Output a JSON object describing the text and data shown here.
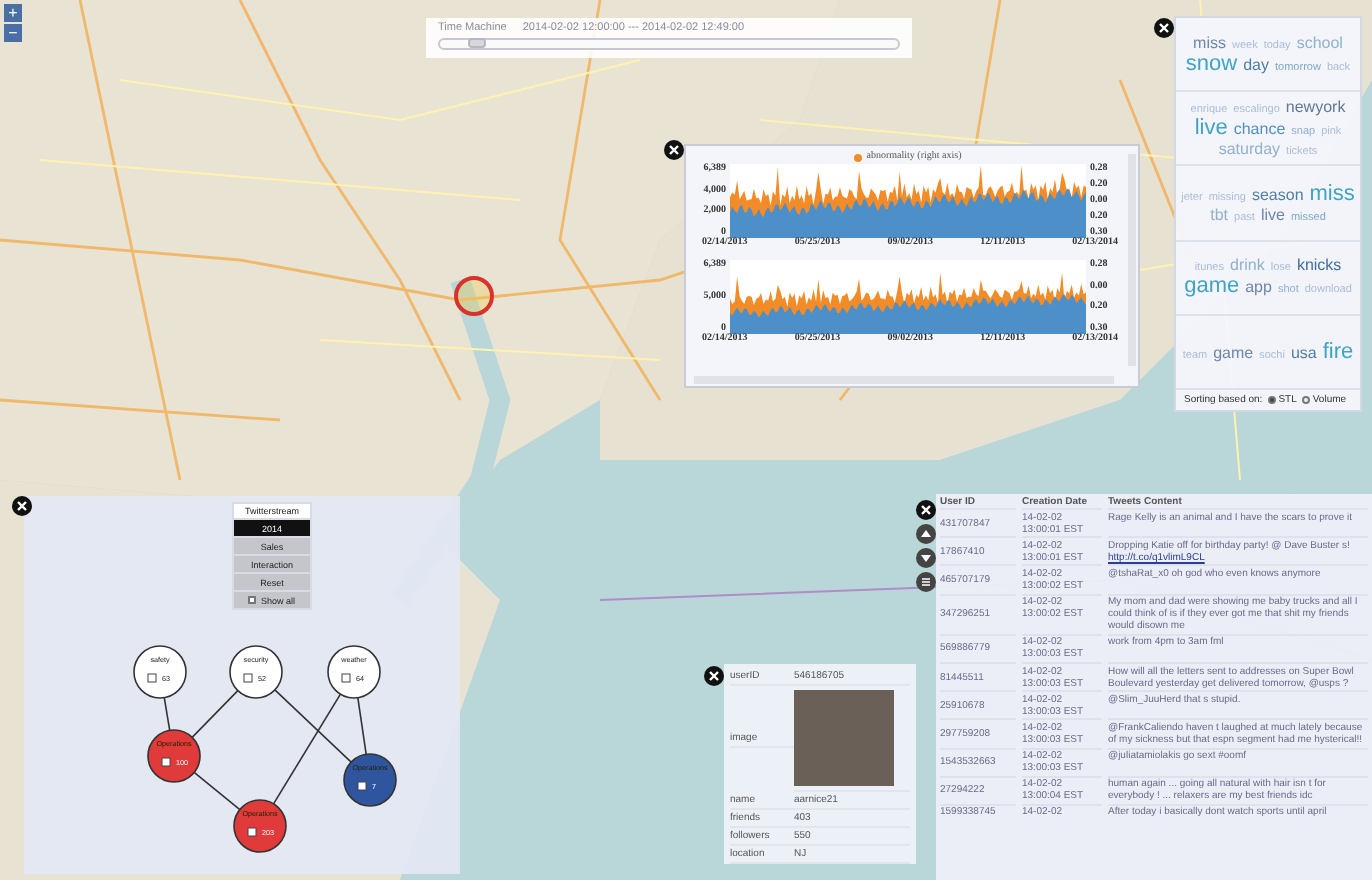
{
  "map": {
    "zoom_in": "+",
    "zoom_out": "−"
  },
  "time_machine": {
    "title": "Time Machine",
    "range": "2014-02-02 12:00:00 --- 2014-02-02 12:49:00",
    "level": 0.08
  },
  "trend_panel": {
    "charts": [
      {
        "legend": "abnormality (right axis)",
        "left_ticks": [
          "6,389",
          "4,000",
          "2,000",
          "0"
        ],
        "right_ticks": [
          "0.28",
          "0.20",
          "0.00",
          "0.20",
          "0.30"
        ],
        "x_labels": [
          "02/14/2013",
          "05/25/2013",
          "09/02/2013",
          "12/11/2013",
          "02/13/2014"
        ]
      },
      {
        "left_ticks": [
          "6,389",
          "5,000",
          "0"
        ],
        "right_ticks": [
          "0.28",
          "0.00",
          "0.20",
          "0.30"
        ],
        "x_labels": [
          "02/14/2013",
          "05/25/2013",
          "09/02/2013",
          "12/11/2013",
          "02/13/2014"
        ]
      }
    ]
  },
  "word_cloud": {
    "sections": [
      {
        "words": [
          {
            "text": "miss",
            "kind": "medium",
            "color": "#6f86a8"
          },
          {
            "text": "week",
            "kind": "small",
            "color": "#a9bdd6"
          },
          {
            "text": "today",
            "kind": "small",
            "color": "#a9bdd6"
          },
          {
            "text": "school",
            "kind": "medium",
            "color": "#8fb0cf"
          },
          {
            "text": "snow",
            "kind": "large",
            "color": "#3fa3c6"
          },
          {
            "text": "day",
            "kind": "medium",
            "color": "#4f7ea8"
          },
          {
            "text": "tomorrow",
            "kind": "small",
            "color": "#7fa6c8"
          },
          {
            "text": "back",
            "kind": "small",
            "color": "#a9bdd6"
          }
        ]
      },
      {
        "words": [
          {
            "text": "enrique",
            "kind": "small",
            "color": "#a9bdd6"
          },
          {
            "text": "escalingo",
            "kind": "small",
            "color": "#a9bdd6"
          },
          {
            "text": "newyork",
            "kind": "medium",
            "color": "#5f7898"
          },
          {
            "text": "live",
            "kind": "large",
            "color": "#3fa3c6"
          },
          {
            "text": "chance",
            "kind": "medium",
            "color": "#4f8fbf"
          },
          {
            "text": "snap",
            "kind": "small",
            "color": "#8fb0cf"
          },
          {
            "text": "pink",
            "kind": "small",
            "color": "#a9bdd6"
          },
          {
            "text": "saturday",
            "kind": "medium",
            "color": "#8fb0cf"
          },
          {
            "text": "tickets",
            "kind": "small",
            "color": "#a9bdd6"
          }
        ]
      },
      {
        "words": [
          {
            "text": "jeter",
            "kind": "small",
            "color": "#a9bdd6"
          },
          {
            "text": "missing",
            "kind": "small",
            "color": "#a9bdd6"
          },
          {
            "text": "season",
            "kind": "medium",
            "color": "#4f7ea8"
          },
          {
            "text": "miss",
            "kind": "large",
            "color": "#3fa3c6"
          },
          {
            "text": "tbt",
            "kind": "medium",
            "color": "#8fb0cf"
          },
          {
            "text": "past",
            "kind": "small",
            "color": "#a9bdd6"
          },
          {
            "text": "live",
            "kind": "medium",
            "color": "#6f86a8"
          },
          {
            "text": "missed",
            "kind": "small",
            "color": "#7fa6c8"
          }
        ]
      },
      {
        "words": [
          {
            "text": "itunes",
            "kind": "small",
            "color": "#a9bdd6"
          },
          {
            "text": "drink",
            "kind": "medium",
            "color": "#8fb0cf"
          },
          {
            "text": "lose",
            "kind": "small",
            "color": "#a9bdd6"
          },
          {
            "text": "knicks",
            "kind": "medium",
            "color": "#3f6f9a"
          },
          {
            "text": "game",
            "kind": "large",
            "color": "#3fa3c6"
          },
          {
            "text": "app",
            "kind": "medium",
            "color": "#6f86a8"
          },
          {
            "text": "shot",
            "kind": "small",
            "color": "#8fb0cf"
          },
          {
            "text": "download",
            "kind": "small",
            "color": "#a9bdd6"
          }
        ]
      },
      {
        "words": [
          {
            "text": "team",
            "kind": "small",
            "color": "#a9bdd6"
          },
          {
            "text": "game",
            "kind": "medium",
            "color": "#6f86a8"
          },
          {
            "text": "sochi",
            "kind": "small",
            "color": "#a9bdd6"
          },
          {
            "text": "usa",
            "kind": "medium",
            "color": "#4f7ea8"
          },
          {
            "text": "fire",
            "kind": "large",
            "color": "#3fa3c6"
          }
        ]
      }
    ],
    "sorting": {
      "label": "Sorting based on:",
      "options": [
        {
          "label": "STL",
          "selected": true
        },
        {
          "label": "Volume",
          "selected": false
        }
      ]
    }
  },
  "topic_graph": {
    "menu": {
      "title": "Twitterstream",
      "items": [
        {
          "label": "2014",
          "selected": true
        },
        {
          "label": "Sales",
          "selected": false
        },
        {
          "label": "Interaction",
          "selected": false
        },
        {
          "label": "Reset",
          "selected": false
        }
      ],
      "show_all": {
        "label": "Show all",
        "checked": false
      }
    },
    "nodes": [
      {
        "label": "safety",
        "count": "63",
        "color": "#ffffff",
        "checked": false
      },
      {
        "label": "security",
        "count": "52",
        "color": "#ffffff",
        "checked": false
      },
      {
        "label": "weather",
        "count": "64",
        "color": "#ffffff",
        "checked": false
      },
      {
        "label": "Operations",
        "count": "100",
        "color": "#e03a3a",
        "checked": false
      },
      {
        "label": "Operations",
        "count": "7",
        "color": "#2f559f",
        "checked": false
      },
      {
        "label": "Operations",
        "count": "203",
        "color": "#e03a3a",
        "checked": false
      }
    ]
  },
  "profile": {
    "rows": [
      {
        "kind": "text",
        "label": "userID",
        "value": "546186705"
      },
      {
        "kind": "image",
        "label": "image"
      },
      {
        "kind": "text",
        "label": "name",
        "value": "aarnice21"
      },
      {
        "kind": "text",
        "label": "friends",
        "value": "403"
      },
      {
        "kind": "text",
        "label": "followers",
        "value": "550"
      },
      {
        "kind": "text",
        "label": "location",
        "value": "NJ"
      }
    ]
  },
  "tweets": {
    "columns": [
      "User ID",
      "Creation Date",
      "Tweets Content"
    ],
    "rows": [
      {
        "user_id": "431707847",
        "date": "14-02-02 13:00:01 EST",
        "content": "Rage Kelly is an animal and I have the scars to prove it"
      },
      {
        "user_id": "17867410",
        "date": "14-02-02 13:00:01 EST",
        "content": "Dropping Katie off for birthday party! @ Dave Buster s!",
        "link": "http://t.co/q1vlimL9CL"
      },
      {
        "user_id": "465707179",
        "date": "14-02-02 13:00:02 EST",
        "content": "@tshaRat_x0 oh god who even knows anymore"
      },
      {
        "user_id": "347296251",
        "date": "14-02-02 13:00:02 EST",
        "content": "My mom and dad were showing me baby trucks and all I could think of is if they ever got me that shit my friends would disown me"
      },
      {
        "user_id": "569886779",
        "date": "14-02-02 13:00:03 EST",
        "content": "work from 4pm to 3am fml"
      },
      {
        "user_id": "81445511",
        "date": "14-02-02 13:00:03 EST",
        "content": "How will all the letters sent to addresses on Super Bowl Boulevard yesterday get delivered tomorrow, @usps ?"
      },
      {
        "user_id": "25910678",
        "date": "14-02-02 13:00:03 EST",
        "content": "@Slim_JuuHerd that s stupid."
      },
      {
        "user_id": "297759208",
        "date": "14-02-02 13:00:03 EST",
        "content": "@FrankCaliendo haven t laughed at much lately because of my sickness but that espn segment had me hysterical!!"
      },
      {
        "user_id": "1543532663",
        "date": "14-02-02 13:00:03 EST",
        "content": "@juliatamiolakis go sext #oomf"
      },
      {
        "user_id": "27294222",
        "date": "14-02-02 13:00:04 EST",
        "content": "human again ... going all natural with hair isn t for everybody ! ... relaxers are my best friends idc"
      },
      {
        "user_id": "1599338745",
        "date": "14-02-02",
        "content": "After today i basically dont watch sports until april"
      }
    ]
  }
}
